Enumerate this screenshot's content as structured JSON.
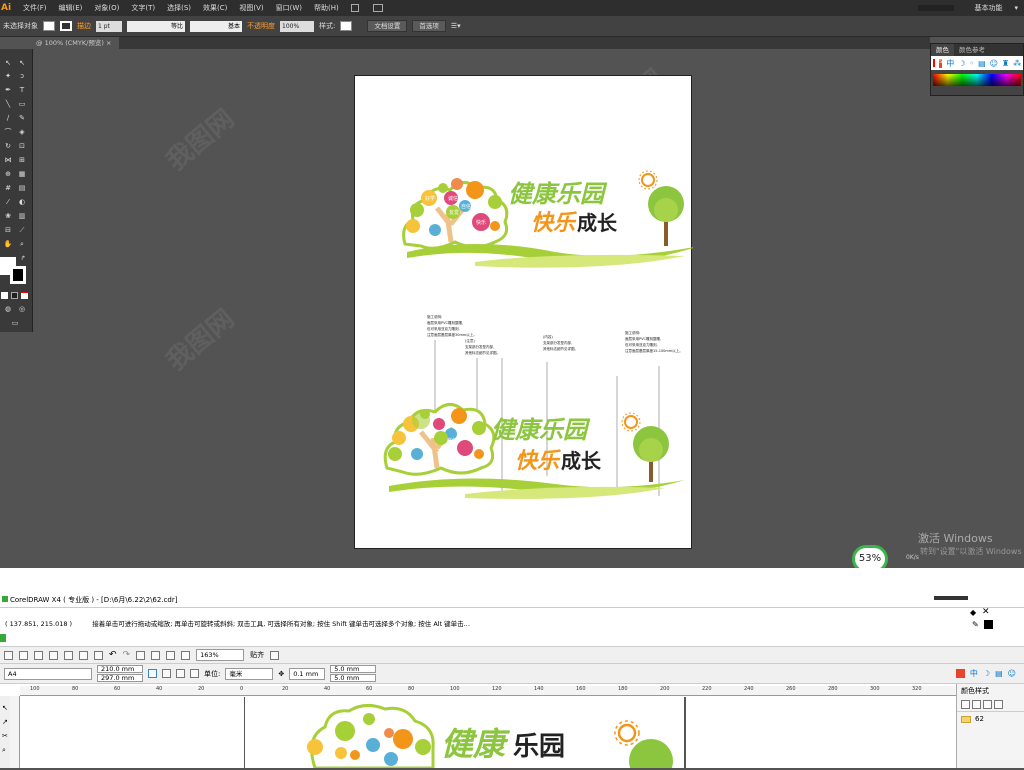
{
  "ai": {
    "logo": "Ai",
    "menu": [
      "文件(F)",
      "编辑(E)",
      "对象(O)",
      "文字(T)",
      "选择(S)",
      "效果(C)",
      "视图(V)",
      "窗口(W)",
      "帮助(H)"
    ],
    "workspace": "基本功能",
    "options": {
      "selection": "未选择对象",
      "stroke_label": "描边",
      "stroke_value": "1 pt",
      "profile": "等比",
      "brush": "基本",
      "opacity_label": "不透明度",
      "opacity_value": "100%",
      "style_label": "样式:",
      "doc_setup": "文档设置",
      "prefs": "首选项"
    },
    "doc_tab": "@ 100% (CMYK/预览)",
    "panel": {
      "tab_color": "颜色",
      "tab_ref": "颜色参考"
    }
  },
  "artboard": {
    "top_title_line1": "健康乐园",
    "top_title_line2_a": "快乐",
    "top_title_line2_b": "成长",
    "bottom_title_line1": "健康乐园",
    "bottom_title_line2_a": "快乐",
    "bottom_title_line2_b": "成长",
    "circle_labels": [
      "好学",
      "诚信",
      "自信",
      "友爱",
      "快乐"
    ],
    "notes": [
      "施工说明:",
      "面层采用PVC雕刻整雕,",
      "包可采用亚克力雕刻,",
      "注意面层基层厚度30mm以上。"
    ]
  },
  "overlay": {
    "win_act": "激活 Windows",
    "win_act_sub": "转到\"设置\"以激活 Windows",
    "speed": "53%",
    "speed_sub": "0K/s"
  },
  "cdr": {
    "title": "CorelDRAW X4 ( 专业版 ) - [D:\\6月\\6.22\\2\\62.cdr]",
    "coord": "( 137.851, 215.018 )",
    "hint": "接着单击可进行拖动或缩放; 再单击可旋转或斜斜; 双击工具, 可选择所有对象; 按住 Shift 键单击可选择多个对象; 按住 Alt 键单击...",
    "zoom": "163%",
    "snap": "贴齐",
    "page": "A4",
    "width": "210.0 mm",
    "height": "297.0 mm",
    "units_label": "单位:",
    "units": "毫米",
    "nudge": "0.1 mm",
    "dup_x": "5.0 mm",
    "dup_y": "5.0 mm",
    "ruler": [
      "100",
      "80",
      "60",
      "40",
      "20",
      "0",
      "20",
      "40",
      "60",
      "80",
      "100",
      "120",
      "140",
      "160",
      "180",
      "200",
      "220",
      "240",
      "260",
      "280",
      "300",
      "320"
    ],
    "docker_title": "颜色样式",
    "docker_item": "62"
  }
}
